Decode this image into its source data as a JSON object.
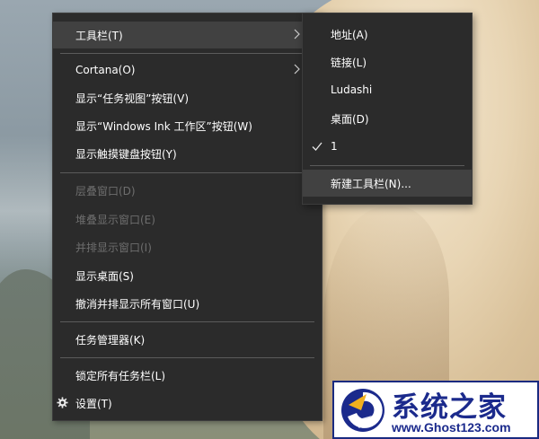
{
  "menu": {
    "items": [
      {
        "label": "工具栏(T)",
        "state": "highlighted",
        "submenu": true
      },
      {
        "label": "Cortana(O)",
        "state": "enabled",
        "submenu": true
      },
      {
        "label": "显示“任务视图”按钮(V)",
        "state": "enabled"
      },
      {
        "label": "显示“Windows Ink 工作区”按钮(W)",
        "state": "enabled"
      },
      {
        "label": "显示触摸键盘按钮(Y)",
        "state": "enabled"
      },
      {
        "label": "层叠窗口(D)",
        "state": "disabled"
      },
      {
        "label": "堆叠显示窗口(E)",
        "state": "disabled"
      },
      {
        "label": "并排显示窗口(I)",
        "state": "disabled"
      },
      {
        "label": "显示桌面(S)",
        "state": "enabled"
      },
      {
        "label": "撤消并排显示所有窗口(U)",
        "state": "enabled"
      },
      {
        "label": "任务管理器(K)",
        "state": "enabled"
      },
      {
        "label": "锁定所有任务栏(L)",
        "state": "enabled"
      },
      {
        "label": "设置(T)",
        "state": "enabled",
        "icon": "gear-icon"
      }
    ]
  },
  "submenu": {
    "items": [
      {
        "label": "地址(A)",
        "checked": false
      },
      {
        "label": "链接(L)",
        "checked": false
      },
      {
        "label": "Ludashi",
        "checked": false
      },
      {
        "label": "桌面(D)",
        "checked": false
      },
      {
        "label": "1",
        "checked": true
      },
      {
        "label": "新建工具栏(N)...",
        "highlighted": true
      }
    ]
  },
  "watermark": {
    "brand": "系统之家",
    "url": "www.Ghost123.com",
    "color": "#1b2a8c"
  },
  "colors": {
    "menu_bg": "#2b2b2b",
    "highlight": "#414141",
    "disabled_text": "#6e6e6e",
    "separator": "#5b5b5b"
  }
}
